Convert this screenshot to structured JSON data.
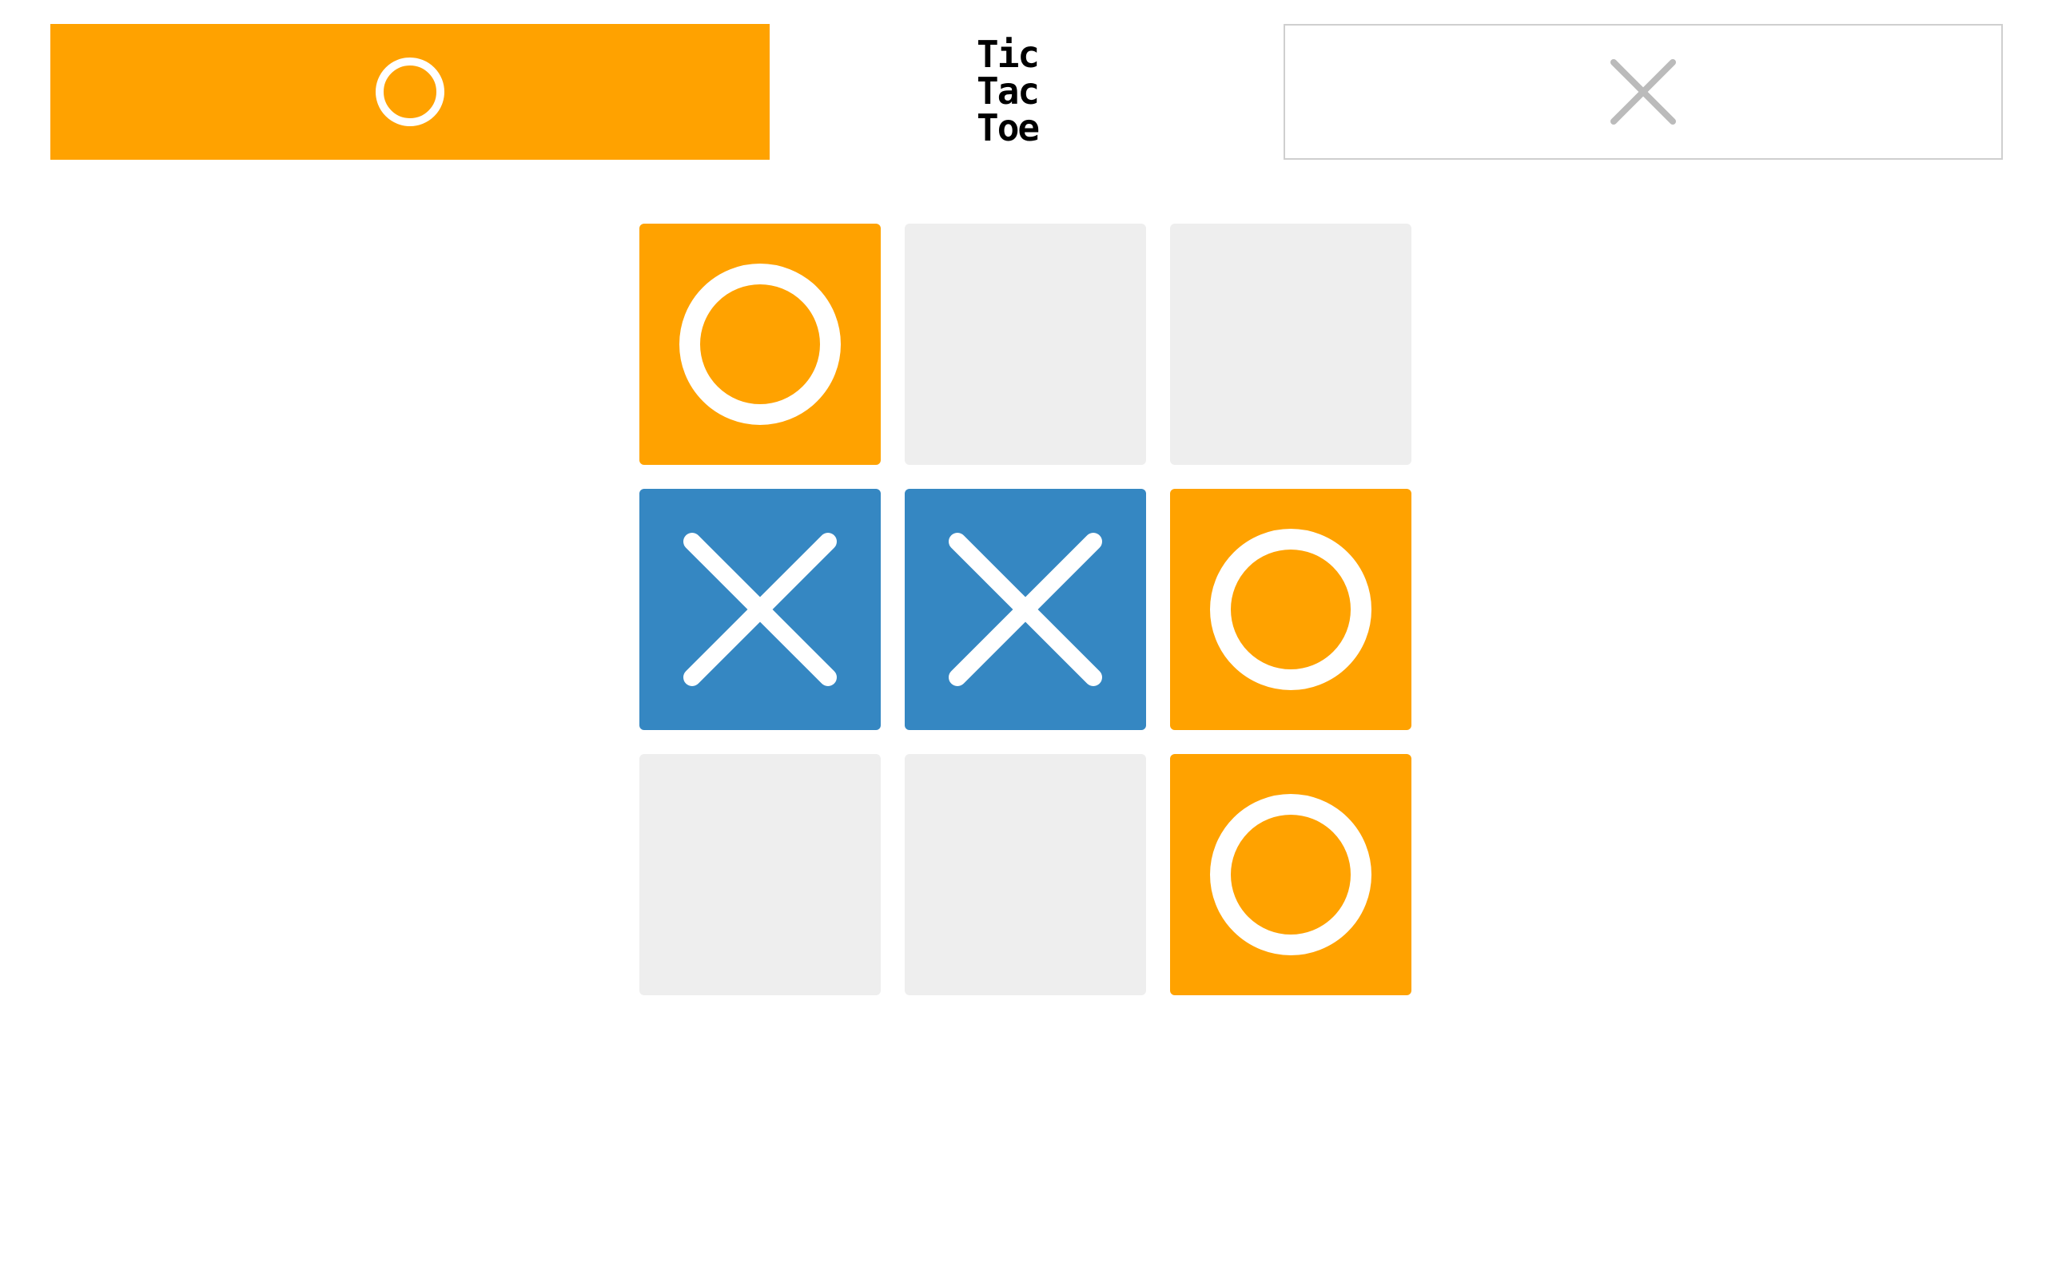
{
  "title": {
    "lines": [
      "Tic",
      "Tac",
      "Toe"
    ]
  },
  "colors": {
    "o_color": "#FFA200",
    "x_color": "#3587C2",
    "empty_cell": "#EEEEEE",
    "inactive_symbol": "#BBBBBB",
    "mark_white": "#FFFFFF"
  },
  "players": [
    {
      "symbol": "O",
      "active": true,
      "icon": "circle-icon"
    },
    {
      "symbol": "X",
      "active": false,
      "icon": "cross-icon"
    }
  ],
  "board": [
    [
      "O",
      "",
      ""
    ],
    [
      "X",
      "X",
      "O"
    ],
    [
      "",
      "",
      "O"
    ]
  ]
}
